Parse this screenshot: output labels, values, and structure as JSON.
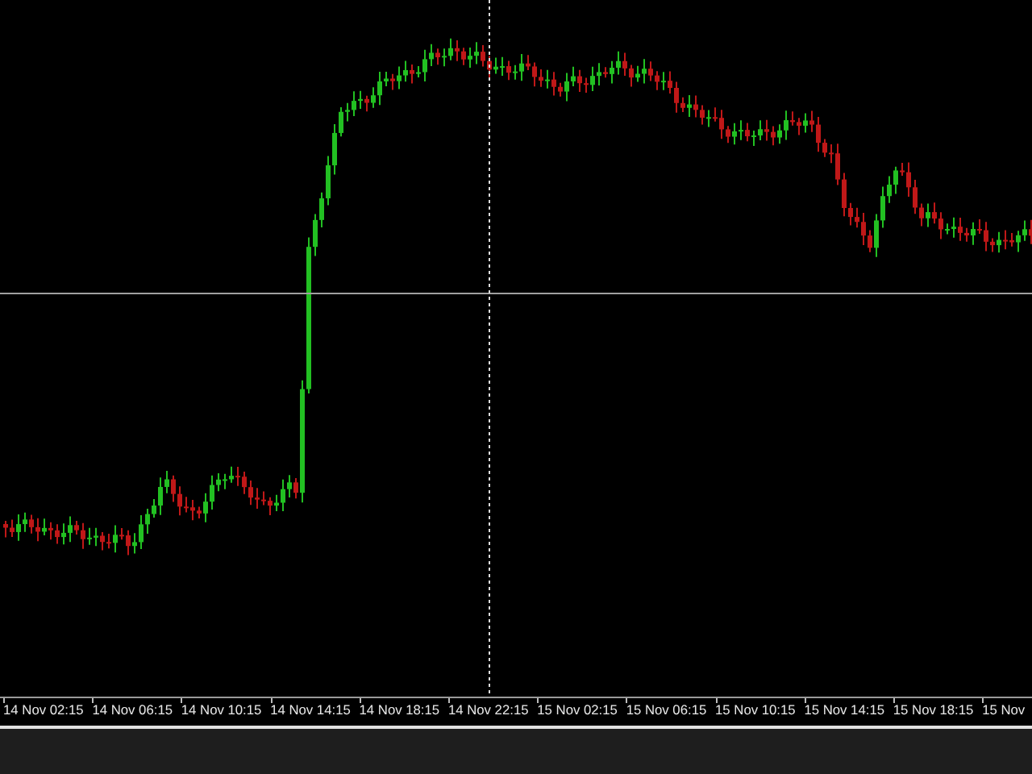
{
  "x_axis": {
    "labels": [
      "14 Nov 02:15",
      "14 Nov 06:15",
      "14 Nov 10:15",
      "14 Nov 14:15",
      "14 Nov 18:15",
      "14 Nov 22:15",
      "15 Nov 02:15",
      "15 Nov 06:15",
      "15 Nov 10:15",
      "15 Nov 14:15",
      "15 Nov 18:15",
      "15 Nov"
    ]
  }
}
